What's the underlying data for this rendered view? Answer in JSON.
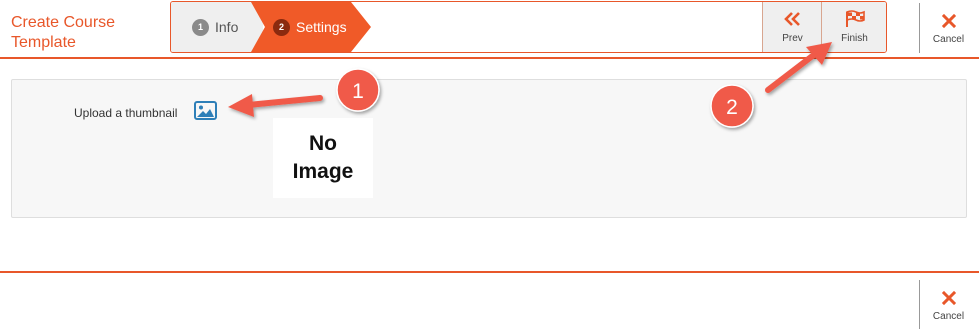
{
  "page": {
    "title": "Create Course Template"
  },
  "wizard": {
    "steps": [
      {
        "number": "1",
        "label": "Info"
      },
      {
        "number": "2",
        "label": "Settings"
      }
    ],
    "prev": {
      "label": "Prev",
      "icon": "double-chevron-left-icon"
    },
    "finish": {
      "label": "Finish",
      "icon": "checkered-flag-icon"
    }
  },
  "cancel": {
    "label": "Cancel",
    "icon": "close-icon"
  },
  "settings": {
    "upload_label": "Upload a thumbnail",
    "thumbnail_icon": "image-icon",
    "no_image_line1": "No",
    "no_image_line2": "Image"
  },
  "annotations": {
    "marker1": "1",
    "marker2": "2",
    "arrow_color": "#f05a4a"
  },
  "colors": {
    "accent": "#e8572a",
    "active_step": "#f05a28",
    "annotation": "#f05a4a"
  }
}
